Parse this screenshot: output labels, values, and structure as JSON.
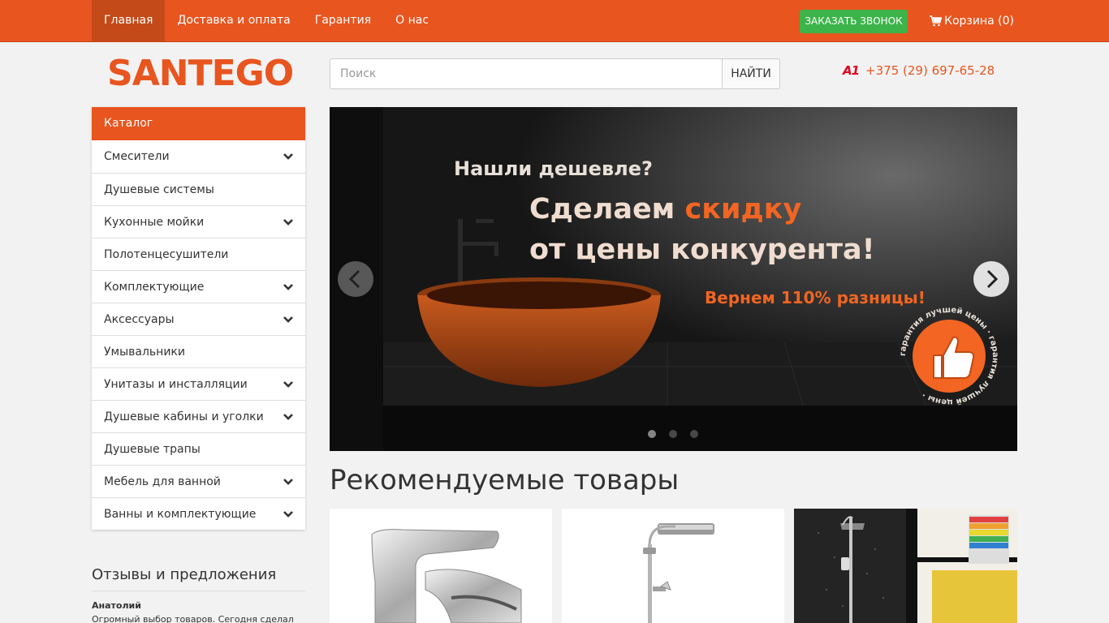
{
  "nav": {
    "items": [
      {
        "label": "Главная",
        "active": true
      },
      {
        "label": "Доставка и оплата",
        "active": false
      },
      {
        "label": "Гарантия",
        "active": false
      },
      {
        "label": "О нас",
        "active": false
      }
    ],
    "callback_label": "ЗАКАЗАТЬ ЗВОНОК",
    "cart_label": "Корзина (0)"
  },
  "header": {
    "logo": "SANTEGO",
    "search_placeholder": "Поиск",
    "search_button": "НАЙТИ",
    "phone_operator": "A1",
    "phone": "+375 (29) 697-65-28"
  },
  "catalog": {
    "title": "Каталог",
    "items": [
      {
        "label": "Смесители",
        "expandable": true
      },
      {
        "label": "Душевые системы",
        "expandable": false
      },
      {
        "label": "Кухонные мойки",
        "expandable": true
      },
      {
        "label": "Полотенцесушители",
        "expandable": false
      },
      {
        "label": "Комплектующие",
        "expandable": true
      },
      {
        "label": "Аксессуары",
        "expandable": true
      },
      {
        "label": "Умывальники",
        "expandable": false
      },
      {
        "label": "Унитазы и инсталляции",
        "expandable": true
      },
      {
        "label": "Душевые кабины и уголки",
        "expandable": true
      },
      {
        "label": "Душевые трапы",
        "expandable": false
      },
      {
        "label": "Мебель для ванной",
        "expandable": true
      },
      {
        "label": "Ванны и комплектующие",
        "expandable": true
      }
    ]
  },
  "reviews": {
    "title": "Отзывы и предложения",
    "author": "Анатолий",
    "text": "Огромный выбор товаров. Сегодня сделал"
  },
  "slider": {
    "line1": "Нашли дешевле?",
    "line2_a": "Сделаем ",
    "line2_b": "скидку",
    "line3": "от цены конкурента!",
    "line4": "Вернем 110% разницы!",
    "badge_text": "гарантия лучшей цены · гарантия лучшей цены ·",
    "active_slide": 1,
    "slide_count": 3
  },
  "products": {
    "title": "Рекомендуемые товары"
  },
  "colors": {
    "brand": "#e8551f",
    "callback": "#3cb44a",
    "accent": "#f26522"
  }
}
